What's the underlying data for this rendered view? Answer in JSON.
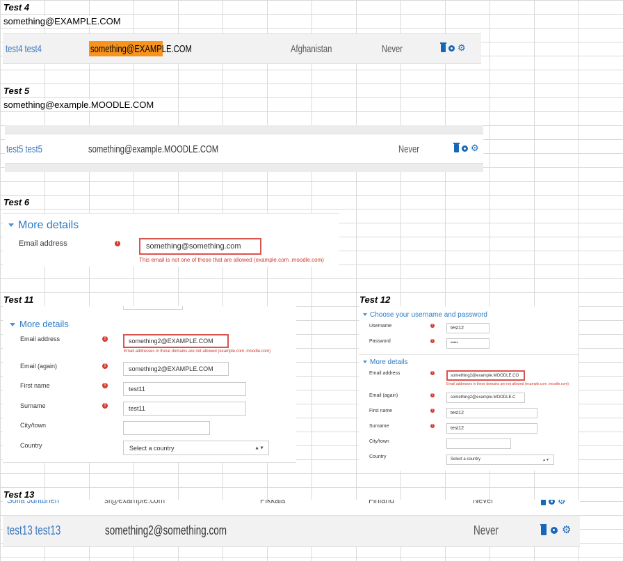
{
  "test4": {
    "label": "Test 4",
    "email_text": "something@EXAMPLE.COM",
    "row": {
      "name": "test4 test4",
      "email": "something@EXAMPLE.COM",
      "country": "Afghanistan",
      "last_access": "Never"
    }
  },
  "test5": {
    "label": "Test 5",
    "email_text": "something@example.MOODLE.COM",
    "row": {
      "name": "test5 test5",
      "email": "something@example.MOODLE.COM",
      "last_access": "Never"
    }
  },
  "test6": {
    "label": "Test 6",
    "section": "More details",
    "email_label": "Email address",
    "email_value": "something@something.com",
    "error": "This email is not one of those that are allowed (example.com .moodle.com)"
  },
  "test11": {
    "label": "Test 11",
    "section": "More details",
    "email_label": "Email address",
    "email_value": "something2@EXAMPLE.COM",
    "error": "Email addresses in these domains are not allowed (example.com .moodle.com)",
    "email_again_label": "Email (again)",
    "email_again_value": "something2@EXAMPLE.COM",
    "firstname_label": "First name",
    "firstname_value": "test11",
    "surname_label": "Surname",
    "surname_value": "test11",
    "city_label": "City/town",
    "city_value": "",
    "country_label": "Country",
    "country_value": "Select a country"
  },
  "test12": {
    "label": "Test 12",
    "section1": "Choose your username and password",
    "username_label": "Username",
    "username_value": "test12",
    "password_label": "Password",
    "password_value": "•••••",
    "section2": "More details",
    "email_label": "Email address",
    "email_value": "something2@example.MOODLE.CO",
    "error": "Email addresses in these domains are not allowed (example.com .moodle.com)",
    "email_again_label": "Email (again)",
    "email_again_value": "something2@example.MOODLE.C",
    "firstname_label": "First name",
    "firstname_value": "test12",
    "surname_label": "Surname",
    "surname_value": "test12",
    "city_label": "City/town",
    "city_value": "",
    "country_label": "Country",
    "country_value": "Select a country"
  },
  "test13": {
    "label": "Test 13",
    "prev_row": {
      "name": "Sofia Juntunen",
      "email": "sf@example.com",
      "city": "Pikkala",
      "country": "Finland",
      "last_access": "Never"
    },
    "row": {
      "name": "test13 test13",
      "email": "something2@something.com",
      "last_access": "Never"
    }
  },
  "colors": {
    "link": "#3b78c2",
    "error": "#d9534f",
    "highlight": "#f7941d",
    "icon": "#1767b8"
  }
}
